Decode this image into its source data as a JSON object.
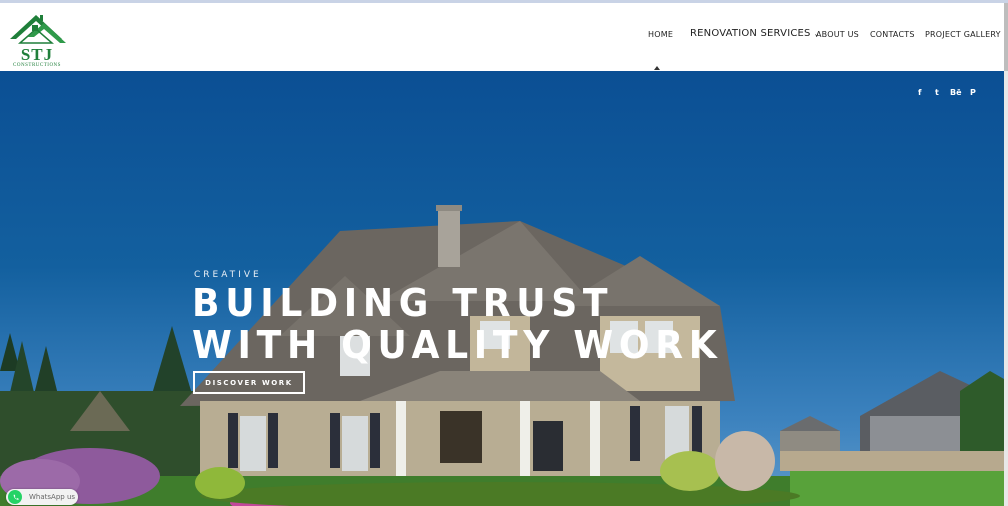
{
  "brand": {
    "name": "STJ",
    "tagline": "CONSTRUCTIONS"
  },
  "nav": {
    "items": [
      {
        "label": "HOME"
      },
      {
        "label": "RENOVATION SERVICES"
      },
      {
        "label": "ABOUT US"
      },
      {
        "label": "CONTACTS"
      },
      {
        "label": "PROJECT GALLERY"
      }
    ]
  },
  "social": {
    "icons": [
      "facebook-icon",
      "twitter-icon",
      "behance-icon",
      "pinterest-icon"
    ],
    "labels": [
      "f",
      "t",
      "Bē",
      "P"
    ]
  },
  "hero": {
    "eyebrow": "CREATIVE",
    "line1": "BUILDING TRUST",
    "line2": "WITH QUALITY WORK",
    "cta": "DISCOVER WORK"
  },
  "whatsapp": {
    "label": "WhatsApp us"
  },
  "colors": {
    "brand_green": "#1f7f3a",
    "sky_blue": "#0b4f94",
    "whatsapp_green": "#25d366"
  }
}
